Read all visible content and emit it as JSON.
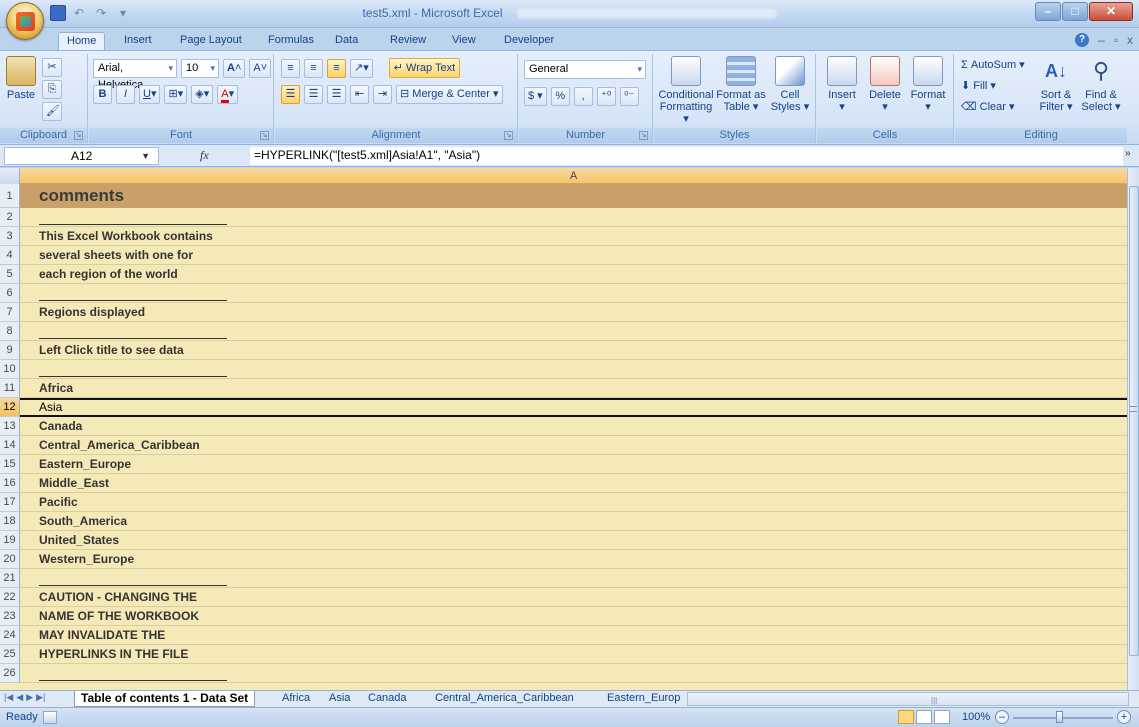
{
  "window": {
    "title": "test5.xml - Microsoft Excel"
  },
  "ribbon": {
    "tabs": [
      "Home",
      "Insert",
      "Page Layout",
      "Formulas",
      "Data",
      "Review",
      "View",
      "Developer"
    ],
    "active_tab": "Home",
    "clipboard": {
      "paste": "Paste",
      "label": "Clipboard"
    },
    "font": {
      "name": "Arial, Helvetica,",
      "size": "10",
      "label": "Font"
    },
    "alignment": {
      "wrap_text": "Wrap Text",
      "merge_center": "Merge & Center",
      "label": "Alignment"
    },
    "number": {
      "format": "General",
      "currency": "$",
      "percent": "%",
      "comma": ",",
      "label": "Number"
    },
    "styles": {
      "conditional_formatting": "Conditional Formatting",
      "format_as_table": "Format as Table",
      "cell_styles": "Cell Styles",
      "label": "Styles"
    },
    "cells": {
      "insert": "Insert",
      "delete": "Delete",
      "format": "Format",
      "label": "Cells"
    },
    "editing": {
      "autosum": "AutoSum",
      "fill": "Fill",
      "clear": "Clear",
      "sort_filter": "Sort & Filter",
      "find_select": "Find & Select",
      "label": "Editing"
    }
  },
  "formula_bar": {
    "name_box": "A12",
    "fx": "fx",
    "formula": "=HYPERLINK(\"[test5.xml]Asia!A1\", \"Asia\")"
  },
  "grid": {
    "column_header": "A",
    "rows": [
      {
        "num": "1",
        "text": "comments"
      },
      {
        "num": "2",
        "text": ""
      },
      {
        "num": "3",
        "text": "This Excel Workbook contains"
      },
      {
        "num": "4",
        "text": "several sheets with one for"
      },
      {
        "num": "5",
        "text": "each region of the world"
      },
      {
        "num": "6",
        "text": ""
      },
      {
        "num": "7",
        "text": "Regions displayed"
      },
      {
        "num": "8",
        "text": ""
      },
      {
        "num": "9",
        "text": "Left Click title to see data"
      },
      {
        "num": "10",
        "text": ""
      },
      {
        "num": "11",
        "text": "Africa"
      },
      {
        "num": "12",
        "text": "Asia"
      },
      {
        "num": "13",
        "text": "Canada"
      },
      {
        "num": "14",
        "text": "Central_America_Caribbean"
      },
      {
        "num": "15",
        "text": "Eastern_Europe"
      },
      {
        "num": "16",
        "text": "Middle_East"
      },
      {
        "num": "17",
        "text": "Pacific"
      },
      {
        "num": "18",
        "text": "South_America"
      },
      {
        "num": "19",
        "text": "United_States"
      },
      {
        "num": "20",
        "text": "Western_Europe"
      },
      {
        "num": "21",
        "text": ""
      },
      {
        "num": "22",
        "text": "CAUTION - CHANGING THE"
      },
      {
        "num": "23",
        "text": "NAME OF THE WORKBOOK"
      },
      {
        "num": "24",
        "text": "MAY INVALIDATE THE"
      },
      {
        "num": "25",
        "text": "HYPERLINKS IN THE FILE"
      },
      {
        "num": "26",
        "text": ""
      }
    ]
  },
  "sheet_tabs": [
    "Table of contents 1 - Data Set",
    "Africa",
    "Asia",
    "Canada",
    "Central_America_Caribbean",
    "Eastern_Europ"
  ],
  "status": {
    "ready": "Ready",
    "zoom": "100%"
  }
}
